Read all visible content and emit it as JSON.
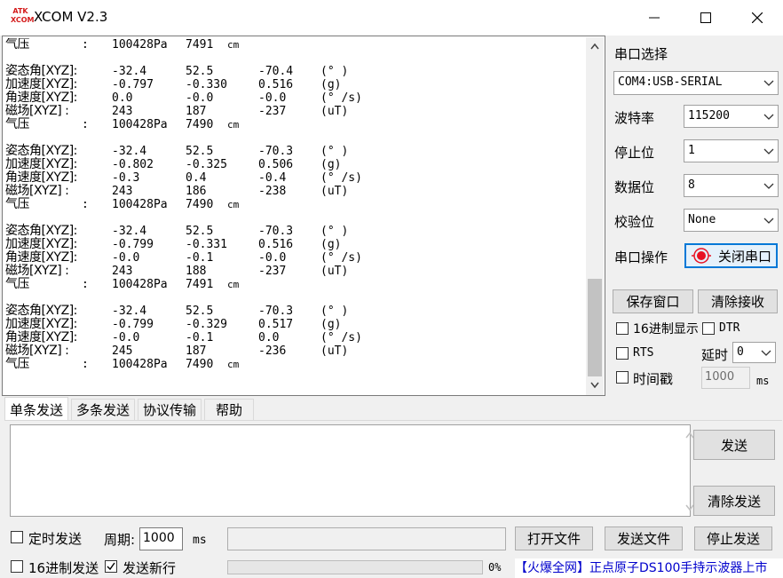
{
  "window": {
    "logo_top": "ATK",
    "logo_bottom": "XCOM",
    "title": "XCOM V2.3"
  },
  "receive": {
    "lines": [
      {
        "label": "气压",
        "sep": ":",
        "v1": "100428Pa",
        "v2": "7491",
        "unit": "cm"
      },
      {
        "blank": true
      },
      {
        "label": "姿态角[XYZ]:",
        "v1": "-32.4",
        "v2": "52.5",
        "v3": "-70.4",
        "unit": "(° )"
      },
      {
        "label": "加速度[XYZ]:",
        "v1": "-0.797",
        "v2": "-0.330",
        "v3": "0.516",
        "unit": "(g)"
      },
      {
        "label": "角速度[XYZ]:",
        "v1": "0.0",
        "v2": "-0.0",
        "v3": "-0.0",
        "unit": "(° /s)"
      },
      {
        "label": "磁场[XYZ]  :",
        "v1": "243",
        "v2": "187",
        "v3": "-237",
        "unit": "(uT)"
      },
      {
        "label": "气压",
        "sep": ":",
        "v1": "100428Pa",
        "v2": "7490",
        "unit": "cm"
      },
      {
        "blank": true
      },
      {
        "label": "姿态角[XYZ]:",
        "v1": "-32.4",
        "v2": "52.5",
        "v3": "-70.3",
        "unit": "(° )"
      },
      {
        "label": "加速度[XYZ]:",
        "v1": "-0.802",
        "v2": "-0.325",
        "v3": "0.506",
        "unit": "(g)"
      },
      {
        "label": "角速度[XYZ]:",
        "v1": "-0.3",
        "v2": "0.4",
        "v3": "-0.4",
        "unit": "(° /s)"
      },
      {
        "label": "磁场[XYZ]  :",
        "v1": "243",
        "v2": "186",
        "v3": "-238",
        "unit": "(uT)"
      },
      {
        "label": "气压",
        "sep": ":",
        "v1": "100428Pa",
        "v2": "7490",
        "unit": "cm"
      },
      {
        "blank": true
      },
      {
        "label": "姿态角[XYZ]:",
        "v1": "-32.4",
        "v2": "52.5",
        "v3": "-70.3",
        "unit": "(° )"
      },
      {
        "label": "加速度[XYZ]:",
        "v1": "-0.799",
        "v2": "-0.331",
        "v3": "0.516",
        "unit": "(g)"
      },
      {
        "label": "角速度[XYZ]:",
        "v1": "-0.0",
        "v2": "-0.1",
        "v3": "-0.0",
        "unit": "(° /s)"
      },
      {
        "label": "磁场[XYZ]  :",
        "v1": "243",
        "v2": "188",
        "v3": "-237",
        "unit": "(uT)"
      },
      {
        "label": "气压",
        "sep": ":",
        "v1": "100428Pa",
        "v2": "7491",
        "unit": "cm"
      },
      {
        "blank": true
      },
      {
        "label": "姿态角[XYZ]:",
        "v1": "-32.4",
        "v2": "52.5",
        "v3": "-70.3",
        "unit": "(° )"
      },
      {
        "label": "加速度[XYZ]:",
        "v1": "-0.799",
        "v2": "-0.329",
        "v3": "0.517",
        "unit": "(g)"
      },
      {
        "label": "角速度[XYZ]:",
        "v1": "-0.0",
        "v2": "-0.1",
        "v3": "0.0",
        "unit": "(° /s)"
      },
      {
        "label": "磁场[XYZ]  :",
        "v1": "245",
        "v2": "187",
        "v3": "-236",
        "unit": "(uT)"
      },
      {
        "label": "气压",
        "sep": ":",
        "v1": "100428Pa",
        "v2": "7490",
        "unit": "cm"
      }
    ]
  },
  "panel": {
    "port_select_label": "串口选择",
    "port_value": "COM4:USB-SERIAL",
    "baud_label": "波特率",
    "baud_value": "115200",
    "stopbits_label": "停止位",
    "stopbits_value": "1",
    "databits_label": "数据位",
    "databits_value": "8",
    "parity_label": "校验位",
    "parity_value": "None",
    "port_op_label": "串口操作",
    "close_port_button": "关闭串口",
    "save_window_button": "保存窗口",
    "clear_receive_button": "清除接收",
    "hex_display_label": "16进制显示",
    "dtr_label": "DTR",
    "rts_label": "RTS",
    "delay_label": "延时",
    "delay_value": "0",
    "timestamp_label": "时间戳",
    "timestamp_value": "1000",
    "timestamp_unit": "ms"
  },
  "tabs": [
    {
      "label": "单条发送",
      "active": true
    },
    {
      "label": "多条发送",
      "active": false
    },
    {
      "label": "协议传输",
      "active": false
    },
    {
      "label": "帮助",
      "active": false
    }
  ],
  "send": {
    "send_button": "发送",
    "clear_send_button": "清除发送",
    "timed_send_label": "定时发送",
    "period_label": "周期:",
    "period_value": "1000",
    "period_unit": "ms",
    "open_file_button": "打开文件",
    "send_file_button": "发送文件",
    "stop_send_button": "停止发送",
    "hex_send_label": "16进制发送",
    "send_newline_label": "发送新行",
    "progress_percent": "0%",
    "ad_text": "【火爆全网】正点原子DS100手持示波器上市"
  },
  "colors": {
    "accent_blue": "#0078d7",
    "record_red": "#e81123",
    "ad_blue": "#0000cc"
  }
}
